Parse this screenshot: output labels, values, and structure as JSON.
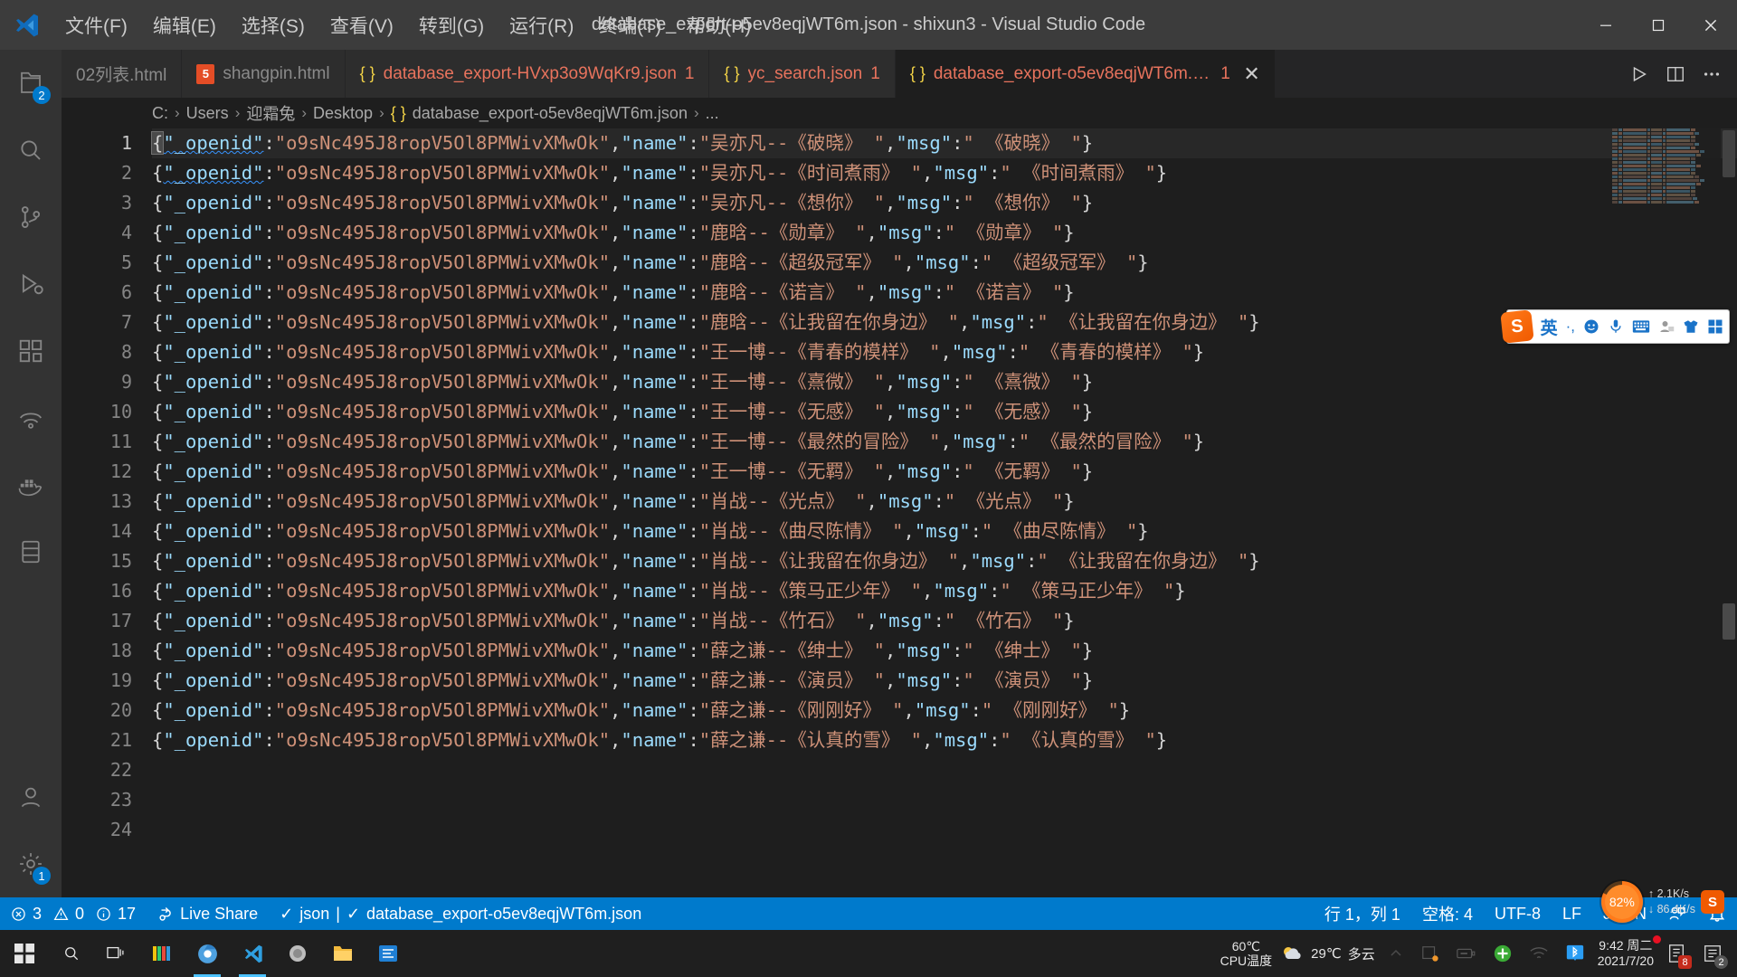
{
  "window": {
    "title": "database_export-o5ev8eqjWT6m.json - shixun3 - Visual Studio Code",
    "minimize_label": "—",
    "maximize_label": "❐",
    "close_label": "✕"
  },
  "menu": [
    {
      "label": "文件(F)",
      "name": "menu-file"
    },
    {
      "label": "编辑(E)",
      "name": "menu-edit"
    },
    {
      "label": "选择(S)",
      "name": "menu-selection"
    },
    {
      "label": "查看(V)",
      "name": "menu-view"
    },
    {
      "label": "转到(G)",
      "name": "menu-go"
    },
    {
      "label": "运行(R)",
      "name": "menu-run"
    },
    {
      "label": "终端(T)",
      "name": "menu-terminal"
    },
    {
      "label": "帮助(H)",
      "name": "menu-help"
    }
  ],
  "activitybar": {
    "items": [
      {
        "name": "explorer",
        "icon": "files-icon",
        "badge": "2",
        "active": false
      },
      {
        "name": "search",
        "icon": "search-icon",
        "badge": "",
        "active": false
      },
      {
        "name": "source-control",
        "icon": "source-control-icon",
        "badge": "",
        "active": false
      },
      {
        "name": "run-debug",
        "icon": "run-and-debug-icon",
        "badge": "",
        "active": false
      },
      {
        "name": "extensions",
        "icon": "extensions-icon",
        "badge": "",
        "active": false
      },
      {
        "name": "remote-explorer",
        "icon": "remote-explorer-icon",
        "badge": "",
        "active": false
      },
      {
        "name": "docker",
        "icon": "docker-icon",
        "badge": "",
        "active": false
      },
      {
        "name": "database",
        "icon": "database-icon",
        "badge": "",
        "active": false
      }
    ],
    "bottom": [
      {
        "name": "accounts",
        "icon": "account-icon",
        "badge": ""
      },
      {
        "name": "settings",
        "icon": "gear-icon",
        "badge": "1"
      }
    ]
  },
  "tabs": [
    {
      "label": "02列表.html",
      "icon": "none",
      "active": false,
      "dirty": false,
      "badge": ""
    },
    {
      "label": "shangpin.html",
      "icon": "html5",
      "active": false,
      "dirty": false,
      "badge": ""
    },
    {
      "label": "database_export-HVxp3o9WqKr9.json",
      "icon": "json",
      "active": false,
      "dirty": false,
      "badge": "1"
    },
    {
      "label": "yc_search.json",
      "icon": "json",
      "active": false,
      "dirty": false,
      "badge": "1"
    },
    {
      "label": "database_export-o5ev8eqjWT6m.json",
      "icon": "json",
      "active": true,
      "dirty": false,
      "badge": "1"
    }
  ],
  "tabbar_actions": [
    {
      "name": "run-file-button",
      "icon": "play-icon"
    },
    {
      "name": "split-editor-button",
      "icon": "split-editor-icon"
    },
    {
      "name": "more-actions-button",
      "icon": "ellipsis-icon"
    }
  ],
  "breadcrumbs": [
    "C:",
    "Users",
    "迎霜兔",
    "Desktop",
    "database_export-o5ev8eqjWT6m.json",
    "..."
  ],
  "editor": {
    "openid": "o9sNc495J8ropV5Ol8PMWivXMwOk",
    "key_openid": "_openid",
    "key_name": "name",
    "key_msg": "msg",
    "total_lines": 24,
    "records": [
      {
        "n": 1,
        "artist": "吴亦凡",
        "song": "《破晓》"
      },
      {
        "n": 2,
        "artist": "吴亦凡",
        "song": "《时间煮雨》"
      },
      {
        "n": 3,
        "artist": "吴亦凡",
        "song": "《想你》"
      },
      {
        "n": 4,
        "artist": "鹿晗",
        "song": "《勋章》"
      },
      {
        "n": 5,
        "artist": "鹿晗",
        "song": "《超级冠军》"
      },
      {
        "n": 6,
        "artist": "鹿晗",
        "song": "《诺言》"
      },
      {
        "n": 7,
        "artist": "鹿晗",
        "song": "《让我留在你身边》"
      },
      {
        "n": 8,
        "artist": "王一博",
        "song": "《青春的模样》"
      },
      {
        "n": 9,
        "artist": "王一博",
        "song": "《熹微》"
      },
      {
        "n": 10,
        "artist": "王一博",
        "song": "《无感》"
      },
      {
        "n": 11,
        "artist": "王一博",
        "song": "《最然的冒险》"
      },
      {
        "n": 12,
        "artist": "王一博",
        "song": "《无羁》"
      },
      {
        "n": 13,
        "artist": "肖战",
        "song": "《光点》"
      },
      {
        "n": 14,
        "artist": "肖战",
        "song": "《曲尽陈情》"
      },
      {
        "n": 15,
        "artist": "肖战",
        "song": "《让我留在你身边》"
      },
      {
        "n": 16,
        "artist": "肖战",
        "song": "《策马正少年》"
      },
      {
        "n": 17,
        "artist": "肖战",
        "song": "《竹石》"
      },
      {
        "n": 18,
        "artist": "薛之谦",
        "song": "《绅士》"
      },
      {
        "n": 19,
        "artist": "薛之谦",
        "song": "《演员》"
      },
      {
        "n": 20,
        "artist": "薛之谦",
        "song": "《刚刚好》"
      },
      {
        "n": 21,
        "artist": "薛之谦",
        "song": "《认真的雪》"
      }
    ],
    "empty_lines": [
      22,
      23,
      24
    ]
  },
  "statusbar": {
    "errors": "3",
    "warnings": "0",
    "infos": "17",
    "live_share": "Live Share",
    "lang_check": "json",
    "file_check": "database_export-o5ev8eqjWT6m.json",
    "cursor": "行 1，列 1",
    "spaces": "空格: 4",
    "encoding": "UTF-8",
    "eol": "LF",
    "language": "JSON",
    "feedback_icon": "feedback-icon",
    "bell_icon": "bell-icon"
  },
  "ime": {
    "brand": "S",
    "mode": "英",
    "items": [
      "punctuation-icon",
      "emoji-icon",
      "voice-input-icon",
      "soft-keyboard-icon",
      "user-icon",
      "skin-icon",
      "toolbox-icon"
    ]
  },
  "speed_widget": {
    "percent": "82%",
    "up": "2.1K/s",
    "down": "86.4K/s",
    "up_arrow": "↑",
    "down_arrow": "↓"
  },
  "taskbar": {
    "cpu_temp_value": "60℃",
    "cpu_temp_label": "CPU温度",
    "weather_temp": "29℃",
    "weather_desc": "多云",
    "time": "9:42 周二",
    "date": "2021/7/20",
    "badge_red": "8",
    "badge_grey": "2",
    "apps": [
      {
        "name": "start-button",
        "icon": "windows-icon"
      },
      {
        "name": "search-button",
        "icon": "search-icon"
      },
      {
        "name": "task-view-button",
        "icon": "task-view-icon"
      },
      {
        "name": "taskbar-app-colors",
        "icon": "colors-icon"
      },
      {
        "name": "taskbar-app-browser",
        "icon": "browser-icon"
      },
      {
        "name": "taskbar-app-vscode",
        "icon": "vscode-icon"
      },
      {
        "name": "taskbar-app-wechat-devtools",
        "icon": "wechat-devtools-icon"
      },
      {
        "name": "taskbar-app-explorer",
        "icon": "folder-icon"
      },
      {
        "name": "taskbar-app-editor",
        "icon": "editor-icon"
      }
    ]
  },
  "colors": {
    "accent": "#007acc",
    "tab_active_bg": "#1e1e1e",
    "editor_bg": "#1e1e1e",
    "string": "#ce9178",
    "key": "#9cdcfe",
    "json_icon": "#f5d547"
  }
}
